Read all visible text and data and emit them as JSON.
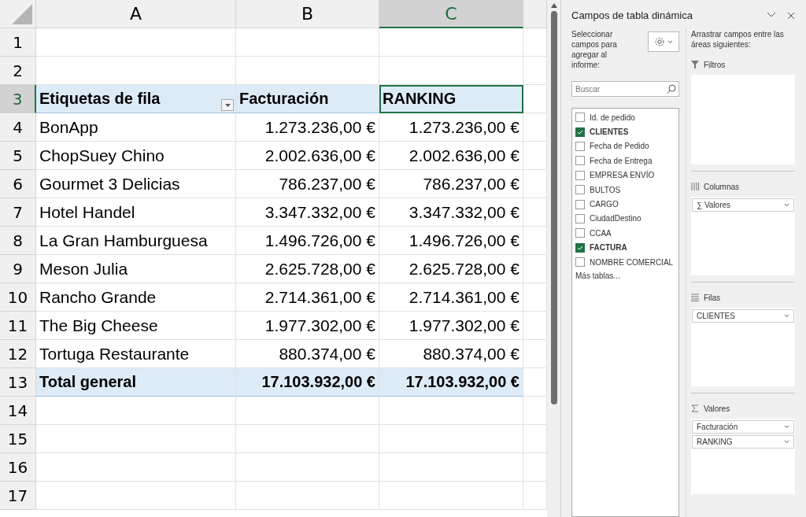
{
  "sheet": {
    "columns": [
      {
        "label": "A",
        "selected": false
      },
      {
        "label": "B",
        "selected": false
      },
      {
        "label": "C",
        "selected": true
      }
    ],
    "rows": [
      {
        "number": "1",
        "selected": false,
        "kind": "empty",
        "cells": []
      },
      {
        "number": "2",
        "selected": false,
        "kind": "empty",
        "cells": []
      },
      {
        "number": "3",
        "selected": true,
        "kind": "header",
        "cells": [
          "Etiquetas de fila",
          "Facturación",
          "RANKING"
        ]
      },
      {
        "number": "4",
        "selected": false,
        "kind": "data",
        "cells": [
          "BonApp",
          "1.273.236,00 €",
          "1.273.236,00 €"
        ]
      },
      {
        "number": "5",
        "selected": false,
        "kind": "data",
        "cells": [
          "ChopSuey Chino",
          "2.002.636,00 €",
          "2.002.636,00 €"
        ]
      },
      {
        "number": "6",
        "selected": false,
        "kind": "data",
        "cells": [
          "Gourmet 3 Delicias",
          "786.237,00 €",
          "786.237,00 €"
        ]
      },
      {
        "number": "7",
        "selected": false,
        "kind": "data",
        "cells": [
          "Hotel Handel",
          "3.347.332,00 €",
          "3.347.332,00 €"
        ]
      },
      {
        "number": "8",
        "selected": false,
        "kind": "data",
        "cells": [
          "La Gran Hamburguesa",
          "1.496.726,00 €",
          "1.496.726,00 €"
        ]
      },
      {
        "number": "9",
        "selected": false,
        "kind": "data",
        "cells": [
          "Meson Julia",
          "2.625.728,00 €",
          "2.625.728,00 €"
        ]
      },
      {
        "number": "10",
        "selected": false,
        "kind": "data",
        "cells": [
          "Rancho Grande",
          "2.714.361,00 €",
          "2.714.361,00 €"
        ]
      },
      {
        "number": "11",
        "selected": false,
        "kind": "data",
        "cells": [
          "The Big Cheese",
          "1.977.302,00 €",
          "1.977.302,00 €"
        ]
      },
      {
        "number": "12",
        "selected": false,
        "kind": "data",
        "cells": [
          "Tortuga Restaurante",
          "880.374,00 €",
          "880.374,00 €"
        ]
      },
      {
        "number": "13",
        "selected": false,
        "kind": "total",
        "cells": [
          "Total general",
          "17.103.932,00 €",
          "17.103.932,00 €"
        ]
      },
      {
        "number": "14",
        "selected": false,
        "kind": "empty",
        "cells": []
      },
      {
        "number": "15",
        "selected": false,
        "kind": "empty",
        "cells": []
      },
      {
        "number": "16",
        "selected": false,
        "kind": "empty",
        "cells": []
      },
      {
        "number": "17",
        "selected": false,
        "kind": "empty",
        "cells": []
      }
    ]
  },
  "pivot_panel": {
    "title": "Campos de tabla dinámica",
    "choose_label": "Seleccionar campos para agregar al informe:",
    "search": {
      "placeholder": "Buscar"
    },
    "fields": [
      {
        "label": "Id. de pedido",
        "checked": false
      },
      {
        "label": "CLIENTES",
        "checked": true
      },
      {
        "label": "Fecha de Pedido",
        "checked": false
      },
      {
        "label": "Fecha de Entrega",
        "checked": false
      },
      {
        "label": "EMPRESA ENVÍO",
        "checked": false
      },
      {
        "label": "BULTOS",
        "checked": false
      },
      {
        "label": "CARGO",
        "checked": false
      },
      {
        "label": "CiudadDestino",
        "checked": false
      },
      {
        "label": "CCAA",
        "checked": false
      },
      {
        "label": "FACTURA",
        "checked": true
      },
      {
        "label": "NOMBRE COMERCIAL",
        "checked": false
      }
    ],
    "more_tables": "Más tablas...",
    "drag_label": "Arrastrar campos entre las áreas siguientes:",
    "areas": [
      {
        "kind": "filter",
        "title": "Filtros"
      },
      {
        "kind": "columns",
        "title": "Columnas",
        "items": [
          "∑ Valores"
        ]
      },
      {
        "kind": "rows",
        "title": "Filas",
        "items": [
          "CLIENTES"
        ]
      },
      {
        "kind": "values",
        "title": "Valores",
        "items": [
          "Facturación",
          "RANKING"
        ]
      }
    ]
  }
}
